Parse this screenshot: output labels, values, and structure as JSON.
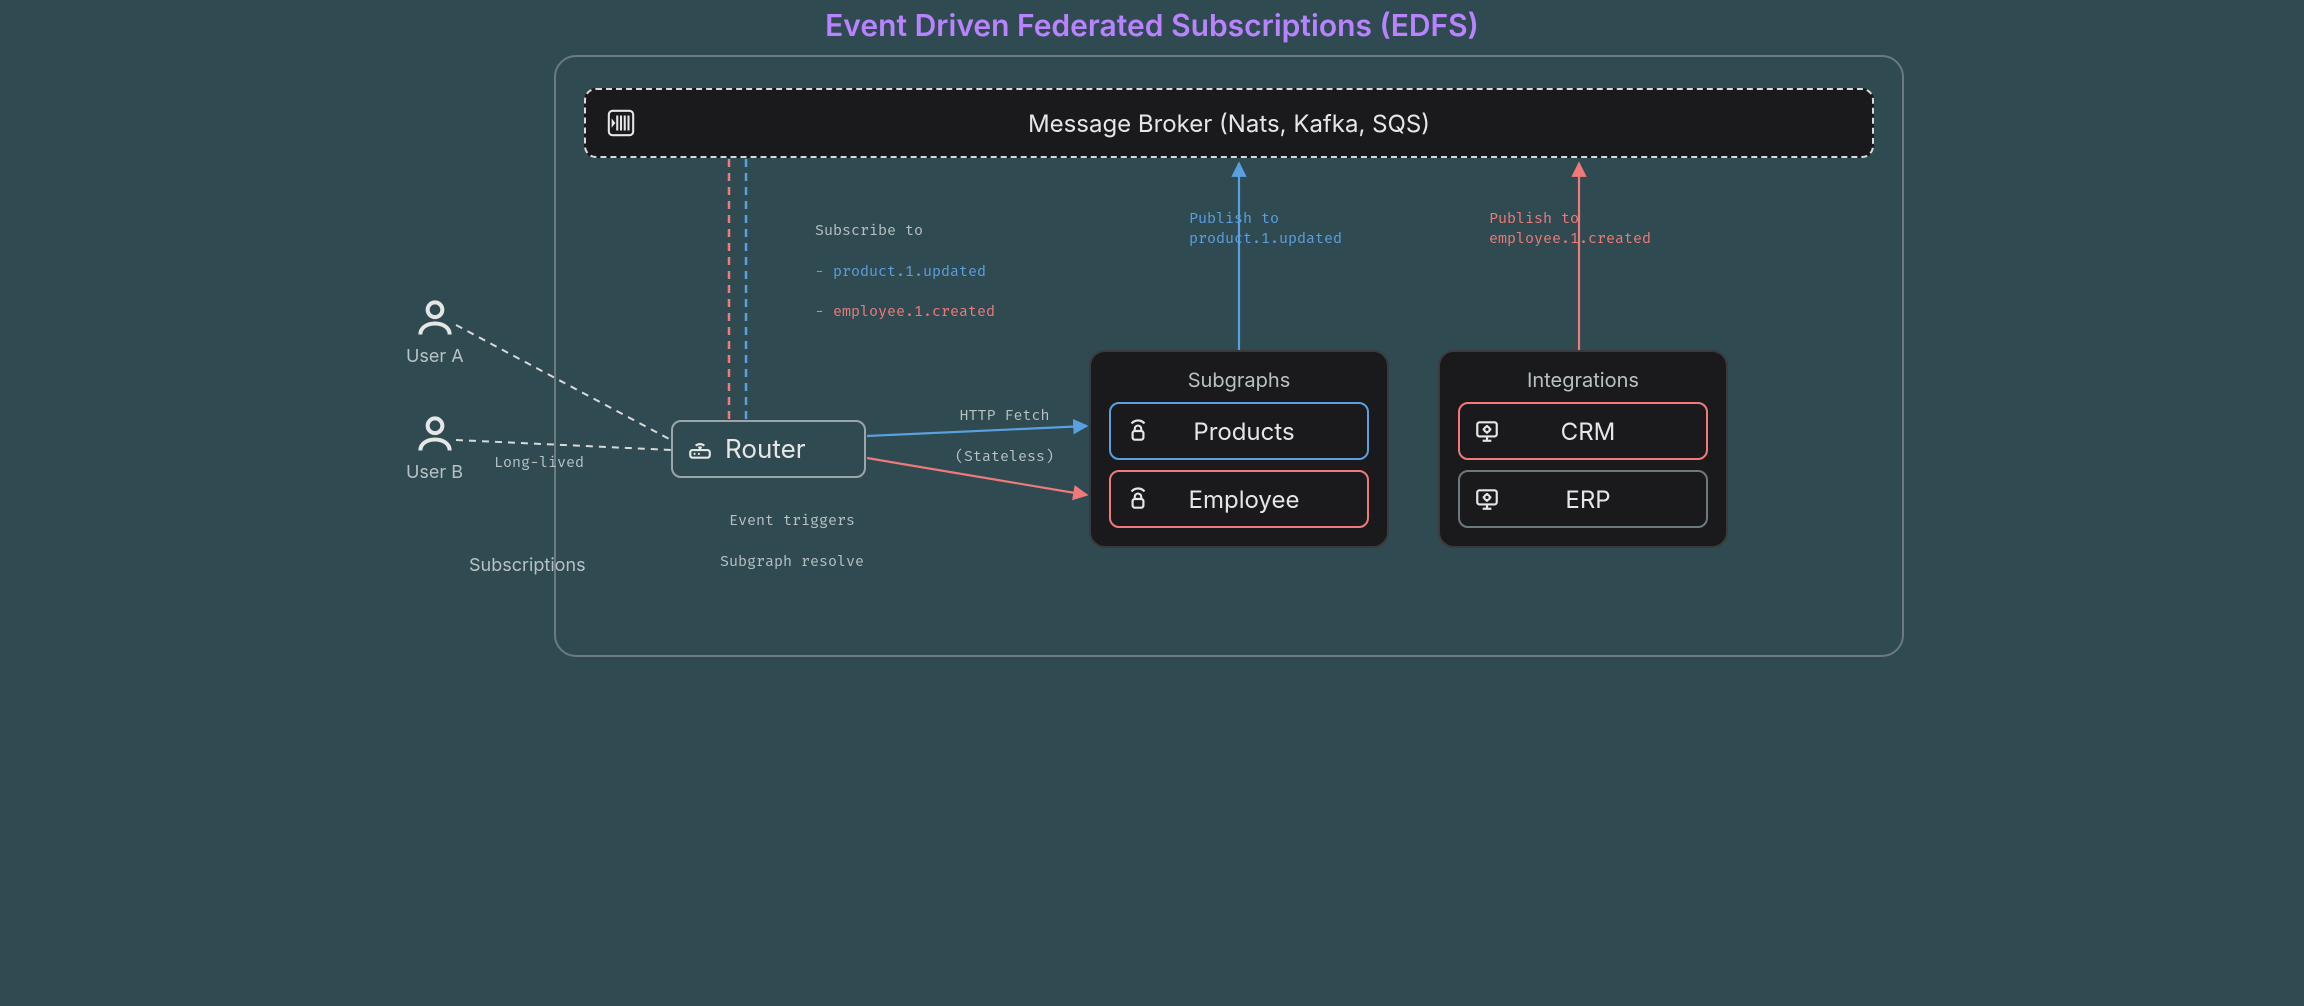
{
  "title": "Event Driven Federated Subscriptions (EDFS)",
  "broker": {
    "label": "Message Broker (Nats, Kafka, SQS)"
  },
  "users": {
    "a": {
      "label": "User A"
    },
    "b": {
      "label": "User B"
    }
  },
  "labels": {
    "long_lived": "Long-lived",
    "subscriptions": "Subscriptions",
    "event_triggers_line1": "Event triggers",
    "event_triggers_line2": "Subgraph resolve",
    "http_fetch_line1": "HTTP Fetch",
    "http_fetch_line2": "(Stateless)",
    "subscribe_header": "Subscribe to",
    "subscribe_item_blue": "- product.1.updated",
    "subscribe_item_red": "- employee.1.created",
    "publish_product": "Publish to\nproduct.1.updated",
    "publish_employee": "Publish to\nemployee.1.created"
  },
  "router": {
    "label": "Router"
  },
  "subgraphs": {
    "title": "Subgraphs",
    "products": "Products",
    "employee": "Employee"
  },
  "integrations": {
    "title": "Integrations",
    "crm": "CRM",
    "erp": "ERP"
  },
  "colors": {
    "blue": "#5aa0e0",
    "red": "#f07a7a",
    "title": "#b983ff"
  }
}
